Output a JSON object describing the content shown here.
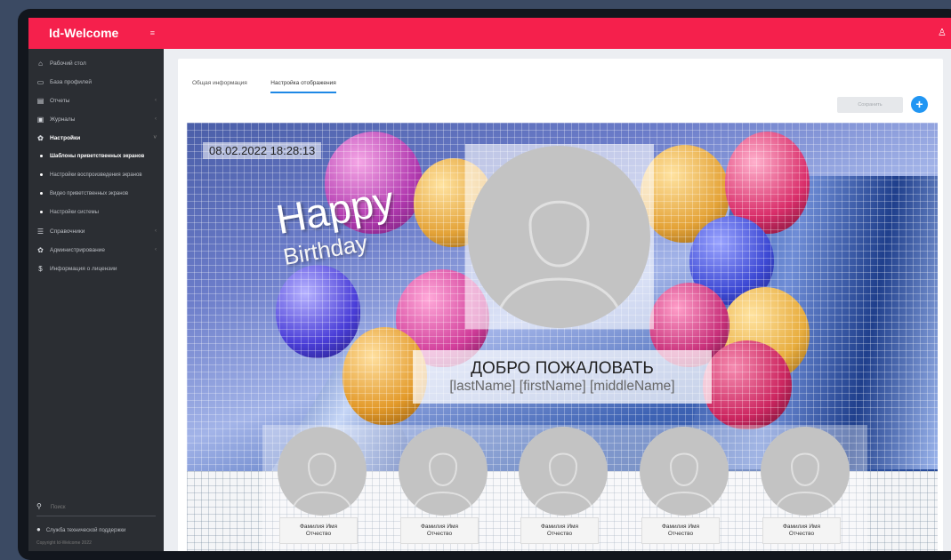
{
  "app": {
    "brand": "Id-Welcome"
  },
  "sidebar": {
    "items": [
      {
        "label": "Рабочий стол",
        "icon": "home-icon"
      },
      {
        "label": "База профилей",
        "icon": "id-card-icon"
      },
      {
        "label": "Отчеты",
        "icon": "report-icon",
        "arrow": "‹"
      },
      {
        "label": "Журналы",
        "icon": "journal-icon",
        "arrow": "‹"
      },
      {
        "label": "Настройки",
        "icon": "gear-icon",
        "arrow": "˅"
      }
    ],
    "subitems": [
      {
        "label": "Шаблоны приветственных экранов"
      },
      {
        "label": "Настройки воспроизведения экранов"
      },
      {
        "label": "Видео приветственных экранов"
      },
      {
        "label": "Настройки системы"
      }
    ],
    "items2": [
      {
        "label": "Справочники",
        "icon": "list-icon",
        "arrow": "‹"
      },
      {
        "label": "Администрирование",
        "icon": "admin-gear-icon",
        "arrow": "‹"
      },
      {
        "label": "Информация о лицензии",
        "icon": "license-icon"
      }
    ],
    "search_placeholder": "Поиск",
    "support": "Служба технической поддержки",
    "copyright": "Copyright Id-Welcome 2022"
  },
  "tabs": [
    {
      "label": "Общая информация"
    },
    {
      "label": "Настройка отображения"
    }
  ],
  "toolbar": {
    "save_label": "Сохранить",
    "add_label": "+"
  },
  "preview": {
    "datetime": "08.02.2022 18:28:13",
    "happy": "Happy",
    "birthday": "Birthday",
    "welcome_title": "ДОБРО ПОЖАЛОВАТЬ",
    "welcome_name": "[lastName] [firstName] [middleName]",
    "thumb_label_line1": "Фамилия Имя",
    "thumb_label_line2": "Отчество"
  },
  "colors": {
    "accent": "#f5204c",
    "sidebar": "#2b2e33",
    "primary_button": "#2196f3"
  }
}
